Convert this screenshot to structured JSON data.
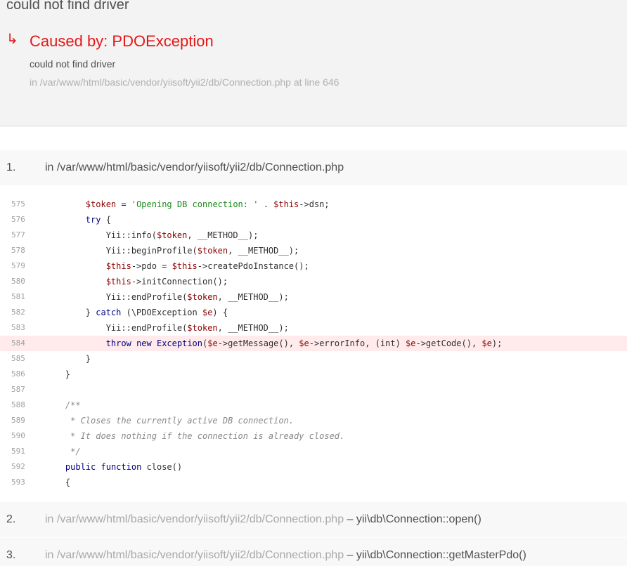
{
  "header": {
    "title": "could not find driver",
    "caused_arrow": "↳",
    "caused_by": "Caused by: PDOException",
    "message": "could not find driver",
    "location": "in /var/www/html/basic/vendor/yiisoft/yii2/db/Connection.php at line 646"
  },
  "stack": [
    {
      "number": "1.",
      "path": "in /var/www/html/basic/vendor/yiisoft/yii2/db/Connection.php",
      "separator": "",
      "method": ""
    },
    {
      "number": "2.",
      "path": "in /var/www/html/basic/vendor/yiisoft/yii2/db/Connection.php",
      "separator": "–",
      "method": "yii\\db\\Connection::open()"
    },
    {
      "number": "3.",
      "path": "in /var/www/html/basic/vendor/yiisoft/yii2/db/Connection.php",
      "separator": "–",
      "method": "yii\\db\\Connection::getMasterPdo()"
    }
  ],
  "code": {
    "error_line": "584",
    "lines": [
      {
        "n": "575",
        "tokens": [
          [
            "p",
            "        "
          ],
          [
            "v",
            "$token"
          ],
          [
            "p",
            " = "
          ],
          [
            "s",
            "'Opening DB connection: '"
          ],
          [
            "p",
            " . "
          ],
          [
            "v",
            "$this"
          ],
          [
            "p",
            "->dsn;"
          ]
        ]
      },
      {
        "n": "576",
        "tokens": [
          [
            "p",
            "        "
          ],
          [
            "k",
            "try"
          ],
          [
            "p",
            " {"
          ]
        ]
      },
      {
        "n": "577",
        "tokens": [
          [
            "p",
            "            Yii::info("
          ],
          [
            "v",
            "$token"
          ],
          [
            "p",
            ", __METHOD__);"
          ]
        ]
      },
      {
        "n": "578",
        "tokens": [
          [
            "p",
            "            Yii::beginProfile("
          ],
          [
            "v",
            "$token"
          ],
          [
            "p",
            ", __METHOD__);"
          ]
        ]
      },
      {
        "n": "579",
        "tokens": [
          [
            "p",
            "            "
          ],
          [
            "v",
            "$this"
          ],
          [
            "p",
            "->pdo = "
          ],
          [
            "v",
            "$this"
          ],
          [
            "p",
            "->createPdoInstance();"
          ]
        ]
      },
      {
        "n": "580",
        "tokens": [
          [
            "p",
            "            "
          ],
          [
            "v",
            "$this"
          ],
          [
            "p",
            "->initConnection();"
          ]
        ]
      },
      {
        "n": "581",
        "tokens": [
          [
            "p",
            "            Yii::endProfile("
          ],
          [
            "v",
            "$token"
          ],
          [
            "p",
            ", __METHOD__);"
          ]
        ]
      },
      {
        "n": "582",
        "tokens": [
          [
            "p",
            "        } "
          ],
          [
            "k",
            "catch"
          ],
          [
            "p",
            " (\\PDOException "
          ],
          [
            "v",
            "$e"
          ],
          [
            "p",
            ") {"
          ]
        ]
      },
      {
        "n": "583",
        "tokens": [
          [
            "p",
            "            Yii::endProfile("
          ],
          [
            "v",
            "$token"
          ],
          [
            "p",
            ", __METHOD__);"
          ]
        ]
      },
      {
        "n": "584",
        "tokens": [
          [
            "p",
            "            "
          ],
          [
            "k",
            "throw"
          ],
          [
            "p",
            " "
          ],
          [
            "k",
            "new"
          ],
          [
            "p",
            " "
          ],
          [
            "k",
            "Exception"
          ],
          [
            "p",
            "("
          ],
          [
            "v",
            "$e"
          ],
          [
            "p",
            "->getMessage(), "
          ],
          [
            "v",
            "$e"
          ],
          [
            "p",
            "->errorInfo, (int) "
          ],
          [
            "v",
            "$e"
          ],
          [
            "p",
            "->getCode(), "
          ],
          [
            "v",
            "$e"
          ],
          [
            "p",
            ");"
          ]
        ]
      },
      {
        "n": "585",
        "tokens": [
          [
            "p",
            "        }"
          ]
        ]
      },
      {
        "n": "586",
        "tokens": [
          [
            "p",
            "    }"
          ]
        ]
      },
      {
        "n": "587",
        "tokens": []
      },
      {
        "n": "588",
        "tokens": [
          [
            "p",
            "    "
          ],
          [
            "c",
            "/**"
          ]
        ]
      },
      {
        "n": "589",
        "tokens": [
          [
            "p",
            "     "
          ],
          [
            "c",
            "* Closes the currently active DB connection."
          ]
        ]
      },
      {
        "n": "590",
        "tokens": [
          [
            "p",
            "     "
          ],
          [
            "c",
            "* It does nothing if the connection is already closed."
          ]
        ]
      },
      {
        "n": "591",
        "tokens": [
          [
            "p",
            "     "
          ],
          [
            "c",
            "*/"
          ]
        ]
      },
      {
        "n": "592",
        "tokens": [
          [
            "p",
            "    "
          ],
          [
            "k",
            "public"
          ],
          [
            "p",
            " "
          ],
          [
            "k",
            "function"
          ],
          [
            "p",
            " close()"
          ]
        ]
      },
      {
        "n": "593",
        "tokens": [
          [
            "p",
            "    {"
          ]
        ]
      }
    ]
  }
}
